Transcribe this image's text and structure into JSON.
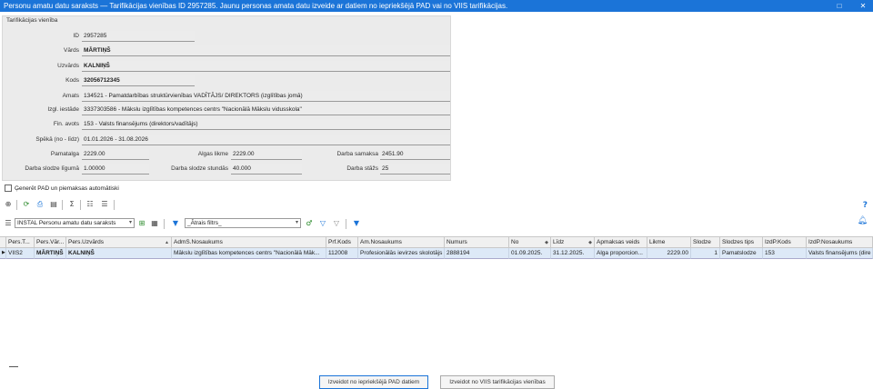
{
  "window": {
    "title": "Personu amatu datu saraksts — Tarifikācijas vienības ID 2957285. Jaunu personas amata datu izveide ar datiem no iepriekšējā PAD vai no VIIS tarifikācijas."
  },
  "panel": {
    "legend": "Tarifikācijas vienība",
    "fields": {
      "id": {
        "label": "ID",
        "value": "2957285"
      },
      "vards": {
        "label": "Vārds",
        "value": "MĀRTIŅŠ"
      },
      "uzvards": {
        "label": "Uzvārds",
        "value": "KALNIŅŠ"
      },
      "kods": {
        "label": "Kods",
        "value": "32056712345"
      },
      "amats": {
        "label": "Amats",
        "value": "134521 - Pamatdarbības struktūrvienības VADĪTĀJS/ DIREKTORS (izglītības jomā)"
      },
      "izgl_iestade": {
        "label": "Izgl. iestāde",
        "value": "3337303586 - Mākslu izglītības kompetences centrs \"Nacionālā Mākslu vidusskola\""
      },
      "fin_avots": {
        "label": "Fin. avots",
        "value": "153 - Valsts finansējums (direktors/vadītājs)"
      },
      "speka": {
        "label": "Spēkā (no - līdz)",
        "value": "01.01.2026 - 31.08.2026"
      },
      "pamatalga": {
        "label": "Pamatalga",
        "value": "2229.00"
      },
      "algas_likme": {
        "label": "Algas likme",
        "value": "2229.00"
      },
      "darba_samaksa": {
        "label": "Darba samaksa",
        "value": "2451.90"
      },
      "slodze_ligums": {
        "label": "Darba slodze līgumā",
        "value": "1.00000"
      },
      "slodze_stundas": {
        "label": "Darba slodze stundās",
        "value": "40.000"
      },
      "darba_stazs": {
        "label": "Darba stāžs",
        "value": "25"
      }
    }
  },
  "checkbox": {
    "label": "Ģenerēt PAD un piemaksas automātiski"
  },
  "filters": {
    "report_select": "INSTAL Personu amatu datu saraksts",
    "quick_filter": "_Ātrais filtrs_"
  },
  "icons": {
    "toolbar_row1": [
      "add-icon",
      "refresh-icon",
      "print-icon",
      "export-icon",
      "sum-icon",
      "columns-icon",
      "tree-icon"
    ],
    "help": "?",
    "bell": "bell-icon"
  },
  "grid": {
    "columns": [
      "Pers.T...",
      "Pers.Vār...",
      "Pers.Uzvārds",
      "AdmS.Nosaukums",
      "Prf.Kods",
      "Am.Nosaukums",
      "Numurs",
      "No",
      "Līdz",
      "Apmaksas veids",
      "Likme",
      "Slodze",
      "Slodzes tips",
      "IzdP.Kods",
      "IzdP.Nosaukums"
    ],
    "rows": [
      [
        "VIIS2",
        "MĀRTIŅŠ",
        "KALNIŅŠ",
        "Mākslu izglītības kompetences centrs \"Nacionālā Māk...",
        "112008",
        "Profesionālās ievirzes skolotājs",
        "2888194",
        "01.09.2025.",
        "31.12.2025.",
        "Alga proporcion...",
        "2229.00",
        "1",
        "Pamatslodze",
        "153",
        "Valsts finansējums (dire"
      ]
    ]
  },
  "buttons": {
    "from_pad": "Izveidot no iepriekšējā PAD datiem",
    "from_viis": "Izveidot no VIIS tarifikācijas vienības"
  }
}
